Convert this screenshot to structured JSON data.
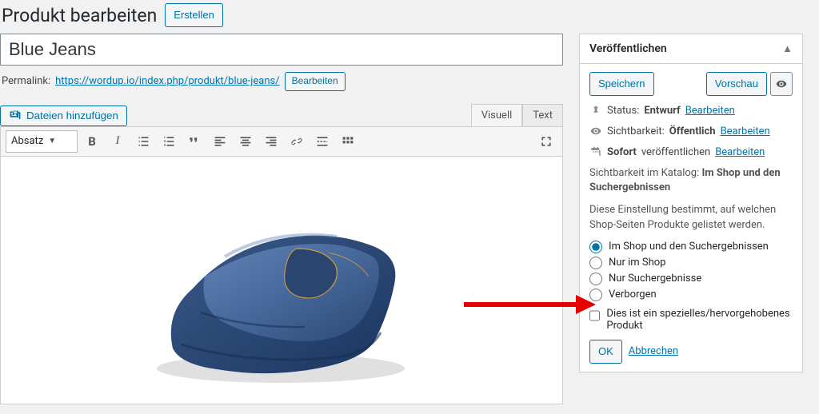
{
  "header": {
    "title": "Produkt bearbeiten",
    "create": "Erstellen"
  },
  "product": {
    "title_value": "Blue Jeans",
    "permalink_label": "Permalink:",
    "permalink_url": "https://wordup.io/index.php/produkt/blue-jeans/",
    "permalink_edit": "Bearbeiten"
  },
  "editor": {
    "add_media": "Dateien hinzufügen",
    "tab_visual": "Visuell",
    "tab_text": "Text",
    "format": "Absatz"
  },
  "publish": {
    "box_title": "Veröffentlichen",
    "save": "Speichern",
    "preview": "Vorschau",
    "status_label": "Status:",
    "status_value": "Entwurf",
    "status_edit": "Bearbeiten",
    "visibility_label": "Sichtbarkeit:",
    "visibility_value": "Öffentlich",
    "visibility_edit": "Bearbeiten",
    "schedule_prefix": "Sofort",
    "schedule_suffix": "veröffentlichen",
    "schedule_edit": "Bearbeiten",
    "catalog_label": "Sichtbarkeit im Katalog:",
    "catalog_value": "Im Shop und den Suchergebnissen",
    "catalog_desc": "Diese Einstellung bestimmt, auf welchen Shop-Seiten Produkte gelistet werden.",
    "options": {
      "shop_search": "Im Shop und den Suchergebnissen",
      "shop": "Nur im Shop",
      "search": "Nur Suchergebnisse",
      "hidden": "Verborgen"
    },
    "featured": "Dies ist ein spezielles/hervorgehobenes Produkt",
    "ok": "OK",
    "cancel": "Abbrechen"
  }
}
